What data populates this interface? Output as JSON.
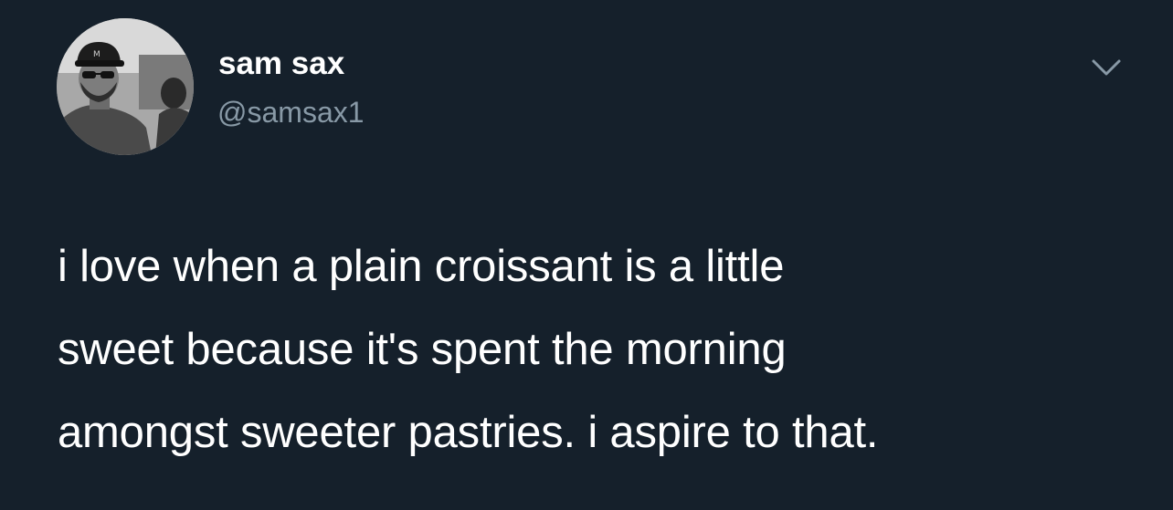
{
  "tweet": {
    "author": {
      "display_name": "sam sax",
      "handle": "@samsax1"
    },
    "text_lines": [
      "i love when a plain croissant is a little",
      "sweet because it's spent the morning",
      "amongst sweeter pastries. i aspire to that."
    ],
    "more_icon": "chevron-down-icon"
  },
  "theme": {
    "background": "#15202b",
    "primary_text": "#ffffff",
    "secondary_text": "#8899a6"
  }
}
